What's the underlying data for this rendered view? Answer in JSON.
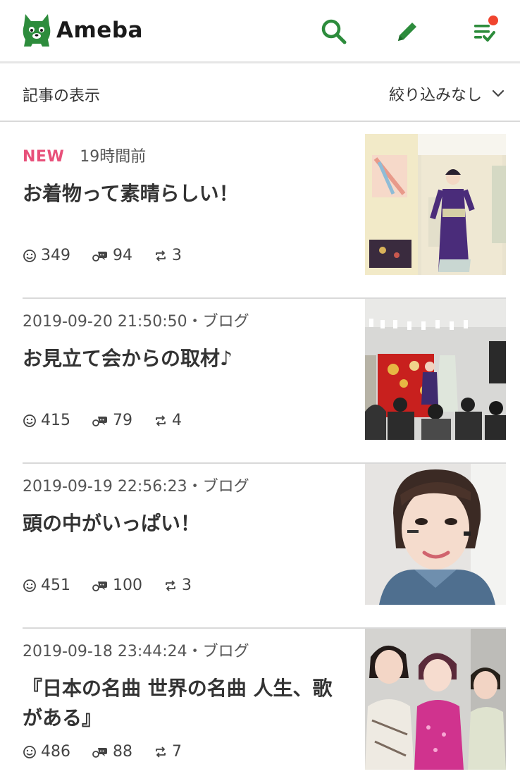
{
  "header": {
    "logo_text": "Ameba",
    "brand_color": "#2d8c3c",
    "notification_color": "#f0442e",
    "icons": [
      "search-icon",
      "edit-pencil-icon",
      "reading-list-icon"
    ]
  },
  "filter": {
    "label": "記事の表示",
    "selected": "絞り込みなし"
  },
  "entries": [
    {
      "is_new": true,
      "new_label": "NEW",
      "meta": "19時間前",
      "title": "お着物って素晴らしい！",
      "likes": "349",
      "comments": "94",
      "reblogs": "3"
    },
    {
      "is_new": false,
      "meta": "2019-09-20 21:50:50・ブログ",
      "title": "お見立て会からの取材♪",
      "likes": "415",
      "comments": "79",
      "reblogs": "4"
    },
    {
      "is_new": false,
      "meta": "2019-09-19 22:56:23・ブログ",
      "title": "頭の中がいっぱい！",
      "likes": "451",
      "comments": "100",
      "reblogs": "3"
    },
    {
      "is_new": false,
      "meta": "2019-09-18 23:44:24・ブログ",
      "title": "『日本の名曲 世界の名曲 人生、歌がある』",
      "likes": "486",
      "comments": "88",
      "reblogs": "7"
    }
  ]
}
